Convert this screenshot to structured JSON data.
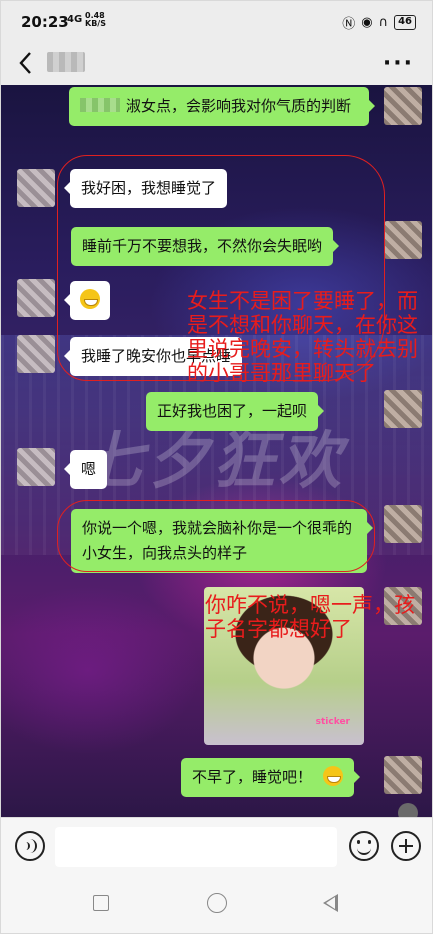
{
  "status_bar": {
    "time": "20:23",
    "signal": "4G",
    "net_speed_value": "0.48",
    "net_speed_unit": "KB/S",
    "battery": "46"
  },
  "header": {
    "contact_name": "********",
    "back_icon": "chevron-left-icon",
    "more_icon": "more-dots-icon",
    "more_label": "···"
  },
  "messages": [
    {
      "side": "out",
      "text": "淑女点，会影响我对你气质的判断",
      "has_redacted_name": true
    },
    {
      "side": "in",
      "text": "我好困，我想睡觉了"
    },
    {
      "side": "out",
      "text": "睡前千万不要想我，不然你会失眠哟"
    },
    {
      "side": "in",
      "type": "emoji",
      "emoji": "grin-emoji"
    },
    {
      "side": "in",
      "text": "我睡了晚安你也早点睡"
    },
    {
      "side": "out",
      "text": "正好我也困了，一起呗"
    },
    {
      "side": "in",
      "text": "嗯"
    },
    {
      "side": "out",
      "text": "你说一个嗯，我就会脑补你是一个很乖的小女生，向我点头的样子"
    },
    {
      "side": "out",
      "type": "sticker",
      "sticker_caption": "sticker"
    },
    {
      "side": "out",
      "text": "不早了，睡觉吧！"
    }
  ],
  "annotations": {
    "note1": "女生不是困了要睡了，而是不想和你聊天，在你这里说完晚安，转头就去别的小哥哥那里聊天了",
    "note2": "你咋不说，嗯一声，孩子名字都想好了",
    "color": "#e81c1c"
  },
  "background_caption": "七夕狂欢",
  "input_bar": {
    "placeholder": "",
    "voice_icon": "voice-icon",
    "emoji_icon": "emoji-icon",
    "plus_icon": "plus-icon"
  },
  "nav_bar": {
    "recent_icon": "square-icon",
    "home_icon": "circle-icon",
    "back_icon": "triangle-back-icon"
  },
  "colors": {
    "outgoing_bubble": "#95ec69",
    "incoming_bubble": "#ffffff",
    "annotation": "#e81c1c"
  }
}
